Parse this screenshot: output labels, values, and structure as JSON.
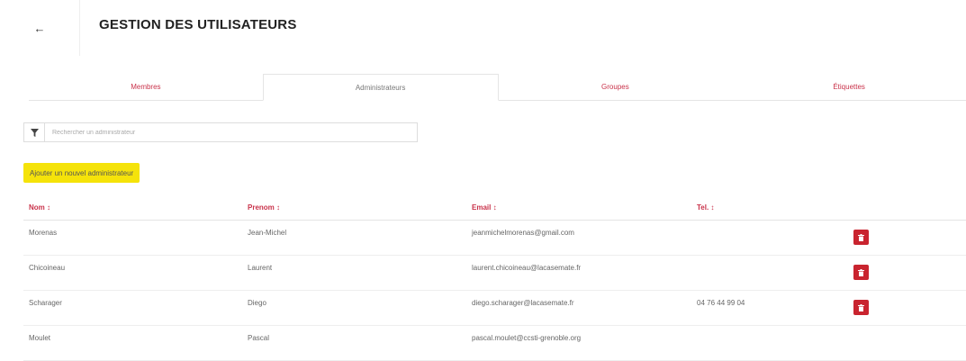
{
  "header": {
    "back_label": "←",
    "title": "GESTION DES UTILISATEURS"
  },
  "tabs": [
    {
      "label": "Membres"
    },
    {
      "label": "Administrateurs"
    },
    {
      "label": "Groupes"
    },
    {
      "label": "Étiquettes"
    }
  ],
  "active_tab": 1,
  "search": {
    "placeholder": "Rechercher un administrateur",
    "value": "",
    "icon": "filter-icon"
  },
  "add_button": {
    "label": "Ajouter un nouvel administrateur",
    "color": "#f5e30a"
  },
  "table": {
    "columns": [
      "Nom ↕",
      "Prenom ↕",
      "Email ↕",
      "Tel. ↕"
    ],
    "rows": [
      {
        "nom": "Morenas",
        "prenom": "Jean-Michel",
        "email": "jeanmichelmorenas@gmail.com",
        "tel": "",
        "delete": true
      },
      {
        "nom": "Chicoineau",
        "prenom": "Laurent",
        "email": "laurent.chicoineau@lacasemate.fr",
        "tel": "",
        "delete": true
      },
      {
        "nom": "Scharager",
        "prenom": "Diego",
        "email": "diego.scharager@lacasemate.fr",
        "tel": "04 76 44 99 04",
        "delete": true
      },
      {
        "nom": "Moulet",
        "prenom": "Pascal",
        "email": "pascal.moulet@ccsti-grenoble.org",
        "tel": "",
        "delete": false
      }
    ]
  },
  "colors": {
    "accent": "#c9324a",
    "delete": "#c9242f"
  }
}
